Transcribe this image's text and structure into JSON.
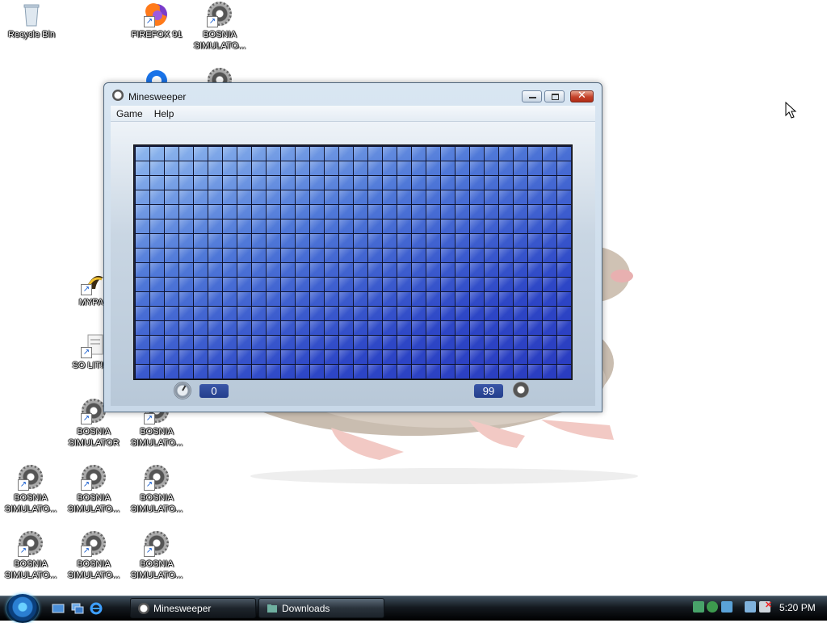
{
  "desktop": {
    "icons": [
      {
        "label": "Recycle Bin"
      },
      {
        "label": "FIREFOX 91"
      },
      {
        "label": "BOSNIA SIMULATO..."
      },
      {
        "label": "MYPAL"
      },
      {
        "label": "SO LIT!! ..."
      },
      {
        "label": "BOSNIA SIMULATOR"
      },
      {
        "label": "BOSNIA SIMULATO..."
      },
      {
        "label": "BOSNIA SIMULATO..."
      },
      {
        "label": "BOSNIA SIMULATO..."
      },
      {
        "label": "BOSNIA SIMULATO..."
      },
      {
        "label": "BOSNIA SIMULATO..."
      },
      {
        "label": "BOSNIA SIMULATO..."
      },
      {
        "label": "BOSNIA SIMULATO..."
      }
    ]
  },
  "window": {
    "title": "Minesweeper",
    "menu": [
      {
        "label": "Game"
      },
      {
        "label": "Help"
      }
    ],
    "board": {
      "columns": 30,
      "rows": 16
    },
    "timer": "0",
    "mines_remaining": "99"
  },
  "taskbar": {
    "buttons": [
      {
        "label": "Minesweeper"
      },
      {
        "label": "Downloads"
      }
    ],
    "clock": "5:20 PM"
  }
}
